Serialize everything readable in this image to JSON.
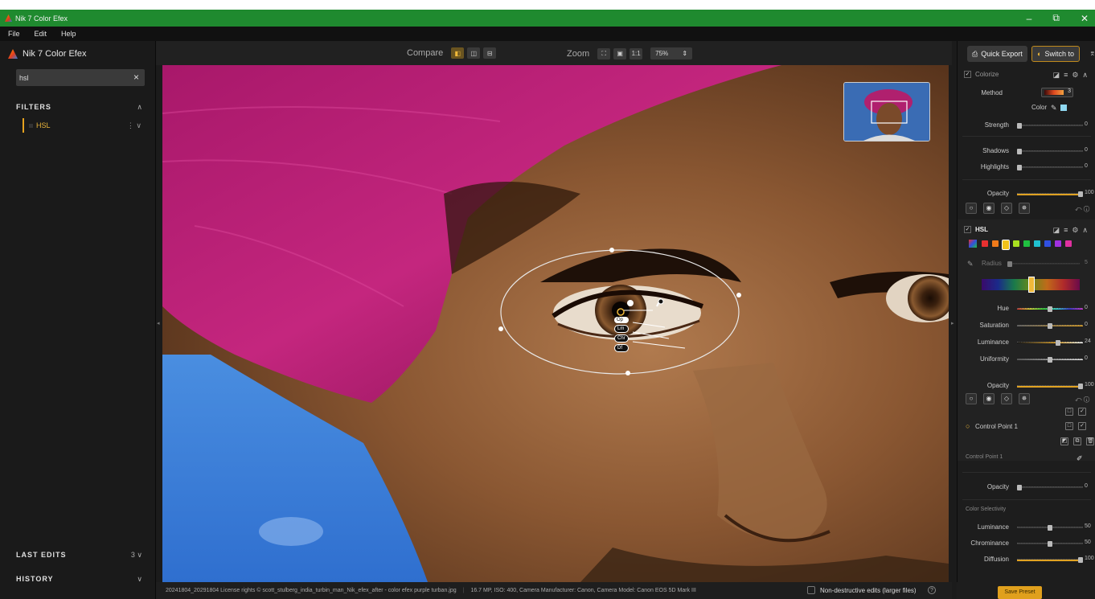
{
  "window": {
    "title": "Nik 7 Color Efex",
    "minimize": "–",
    "restore": "⧉",
    "close": "✕"
  },
  "menu": [
    "File",
    "Edit",
    "Help"
  ],
  "left_panel": {
    "app_title": "Nik 7 Color Efex",
    "search": {
      "value": "hsl",
      "clear": "×"
    },
    "filters_label": "FILTERS",
    "filter_items": [
      {
        "label": "HSL"
      }
    ],
    "last_edits_label": "LAST EDITS",
    "last_edits_count": "3",
    "history_label": "HISTORY"
  },
  "toolbar": {
    "compare_label": "Compare",
    "zoom_label": "Zoom",
    "zoom_1to1": "1:1",
    "zoom_value": "75%"
  },
  "control_point": {
    "chips": [
      "Op",
      "Lm",
      "Chr",
      "Df"
    ]
  },
  "status": {
    "file": "20241804_20291804 License rights © scott_stulberg_india_turbin_man_Nik_efex_after - color efex purple turban.jpg",
    "meta": "16.7 MP, ISO: 400, Camera Manufacturer: Canon, Camera Model: Canon EOS 5D Mark III",
    "nondestructive": "Non-destructive edits (larger files)",
    "help": "?"
  },
  "right_panel": {
    "quick_export": "Quick Export",
    "switch_to": "Switch to",
    "colorize": {
      "name": "Colorize",
      "method_label": "Method",
      "method_value": "3",
      "color_label": "Color",
      "strength_label": "Strength",
      "strength_val": "0",
      "shadows_label": "Shadows",
      "shadows_val": "0",
      "highlights_label": "Highlights",
      "highlights_val": "0",
      "opacity_label": "Opacity",
      "opacity_val": "100"
    },
    "hsl": {
      "name": "HSL",
      "radius_label": "Radius",
      "radius_val": "5",
      "hue_label": "Hue",
      "hue_val": "0",
      "saturation_label": "Saturation",
      "saturation_val": "0",
      "luminance_label": "Luminance",
      "luminance_val": "24",
      "uniformity_label": "Uniformity",
      "uniformity_val": "0",
      "opacity_label": "Opacity",
      "opacity_val": "100",
      "swatch_colors": [
        "#e83030",
        "#f07a1a",
        "#f2c21a",
        "#a8e020",
        "#20c040",
        "#20c0d0",
        "#3050e0",
        "#a030e0",
        "#e030a0"
      ]
    },
    "control_point_name": "Control Point 1",
    "cp_section_label": "Control Point 1",
    "cp_opacity_label": "Opacity",
    "cp_opacity_val": "0",
    "color_selectivity_label": "Color Selectivity",
    "cs_luminance_label": "Luminance",
    "cs_luminance_val": "50",
    "cs_chrominance_label": "Chrominance",
    "cs_chrominance_val": "50",
    "cs_diffusion_label": "Diffusion",
    "cs_diffusion_val": "100",
    "save_preset": "Save Preset"
  }
}
